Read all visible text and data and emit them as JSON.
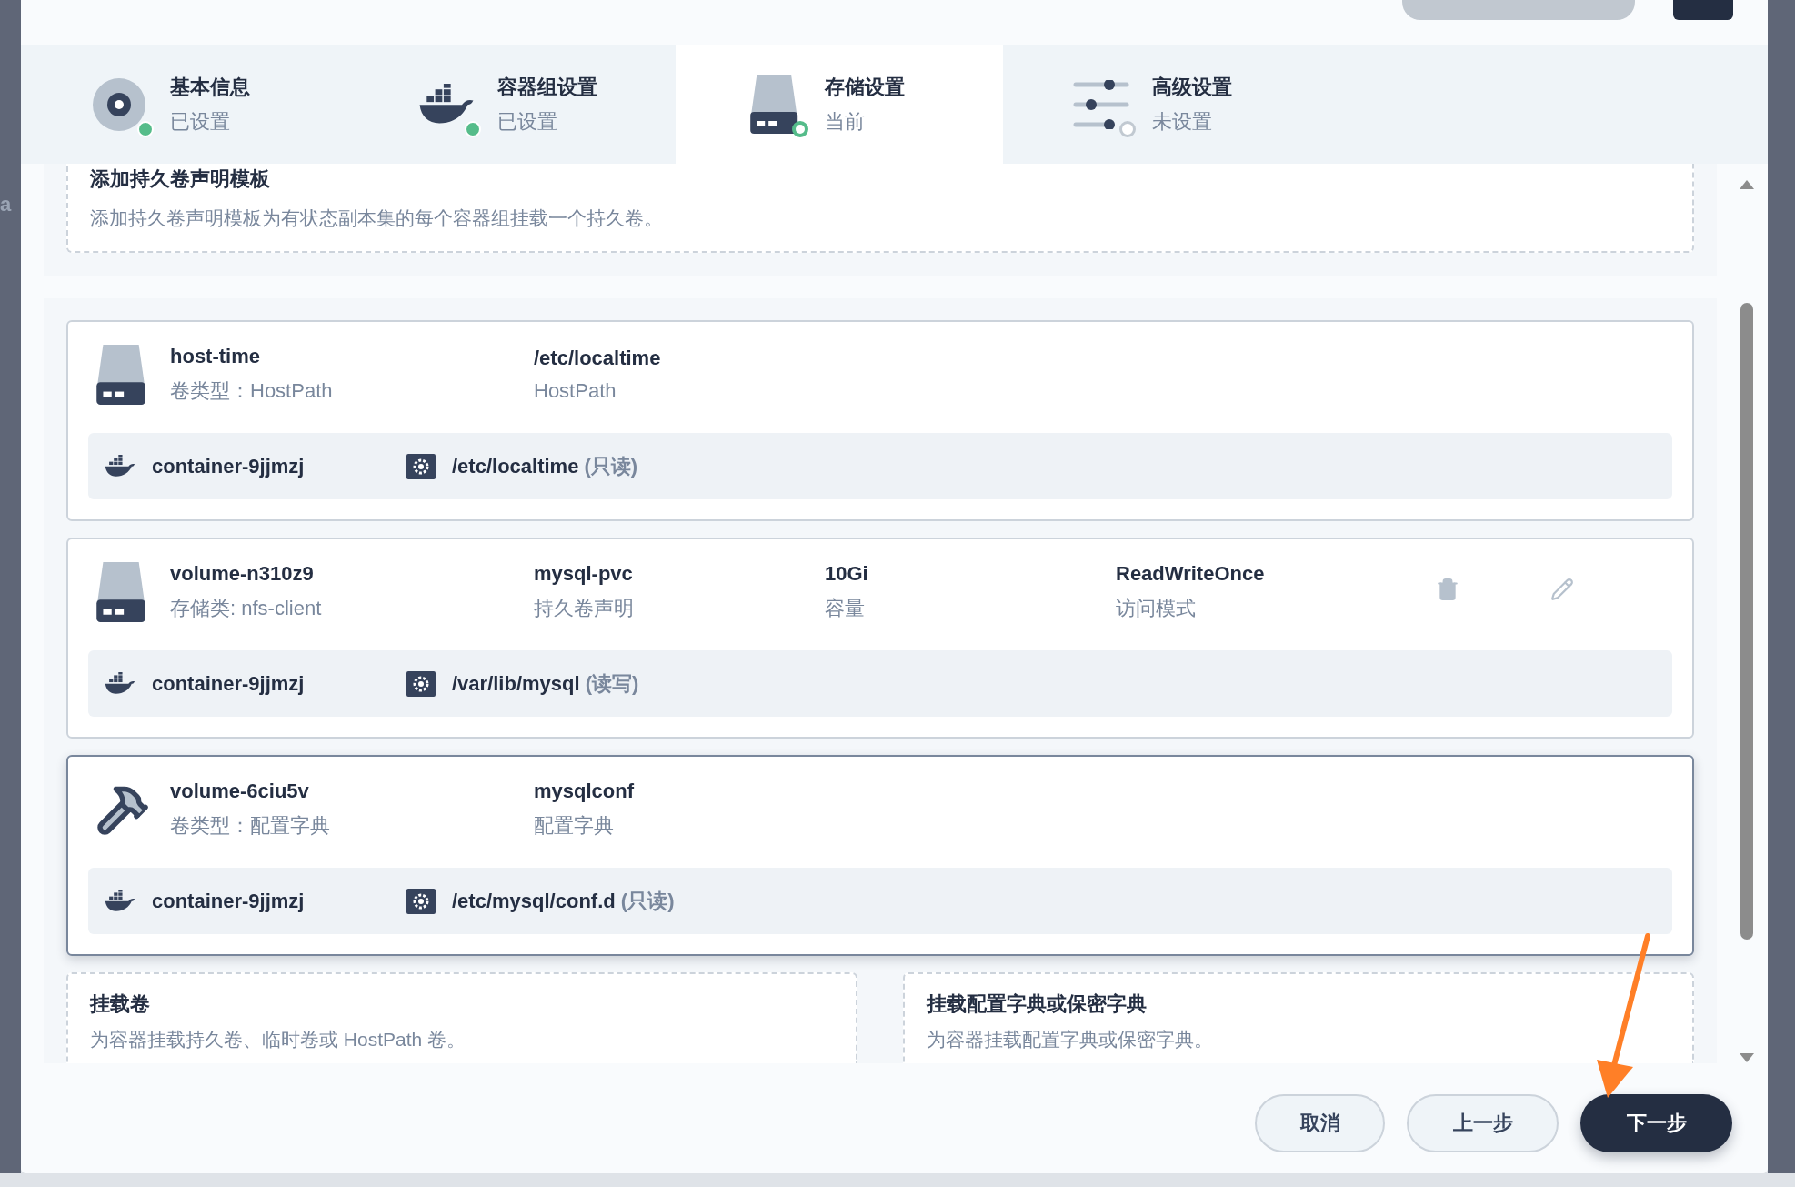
{
  "background_fragment": "a",
  "steps": [
    {
      "title": "基本信息",
      "status_text": "已设置",
      "kind": "disk",
      "complete": true,
      "selected": false
    },
    {
      "title": "容器组设置",
      "status_text": "已设置",
      "kind": "docker",
      "complete": true,
      "selected": false
    },
    {
      "title": "存储设置",
      "status_text": "当前",
      "kind": "drive",
      "complete": false,
      "selected": true
    },
    {
      "title": "高级设置",
      "status_text": "未设置",
      "kind": "sliders",
      "complete": false,
      "selected": false
    }
  ],
  "template_section": {
    "title": "添加持久卷声明模板",
    "description": "添加持久卷声明模板为有状态副本集的每个容器组挂载一个持久卷。"
  },
  "volumes": [
    {
      "kind": "drive",
      "highlighted": false,
      "show_actions": false,
      "columns": [
        {
          "value": "host-time",
          "label": "卷类型：HostPath"
        },
        {
          "value": "/etc/localtime",
          "label": "HostPath"
        }
      ],
      "mount": {
        "container": "container-9jjmzj",
        "path": "/etc/localtime",
        "mode": "(只读)"
      }
    },
    {
      "kind": "drive",
      "highlighted": false,
      "show_actions": true,
      "columns": [
        {
          "value": "volume-n310z9",
          "label": "存储类: nfs-client"
        },
        {
          "value": "mysql-pvc",
          "label": "持久卷声明"
        },
        {
          "value": "10Gi",
          "label": "容量"
        },
        {
          "value": "ReadWriteOnce",
          "label": "访问模式"
        }
      ],
      "mount": {
        "container": "container-9jjmzj",
        "path": "/var/lib/mysql",
        "mode": "(读写)"
      }
    },
    {
      "kind": "hammer",
      "highlighted": true,
      "show_actions": false,
      "columns": [
        {
          "value": "volume-6ciu5v",
          "label": "卷类型：配置字典"
        },
        {
          "value": "mysqlconf",
          "label": "配置字典"
        }
      ],
      "mount": {
        "container": "container-9jjmzj",
        "path": "/etc/mysql/conf.d",
        "mode": "(只读)"
      }
    }
  ],
  "add_options": [
    {
      "title": "挂载卷",
      "description": "为容器挂载持久卷、临时卷或 HostPath 卷。"
    },
    {
      "title": "挂载配置字典或保密字典",
      "description": "为容器挂载配置字典或保密字典。"
    }
  ],
  "footer_buttons": [
    {
      "label": "取消",
      "kind": "secondary"
    },
    {
      "label": "上一步",
      "kind": "secondary"
    },
    {
      "label": "下一步",
      "kind": "primary"
    }
  ]
}
